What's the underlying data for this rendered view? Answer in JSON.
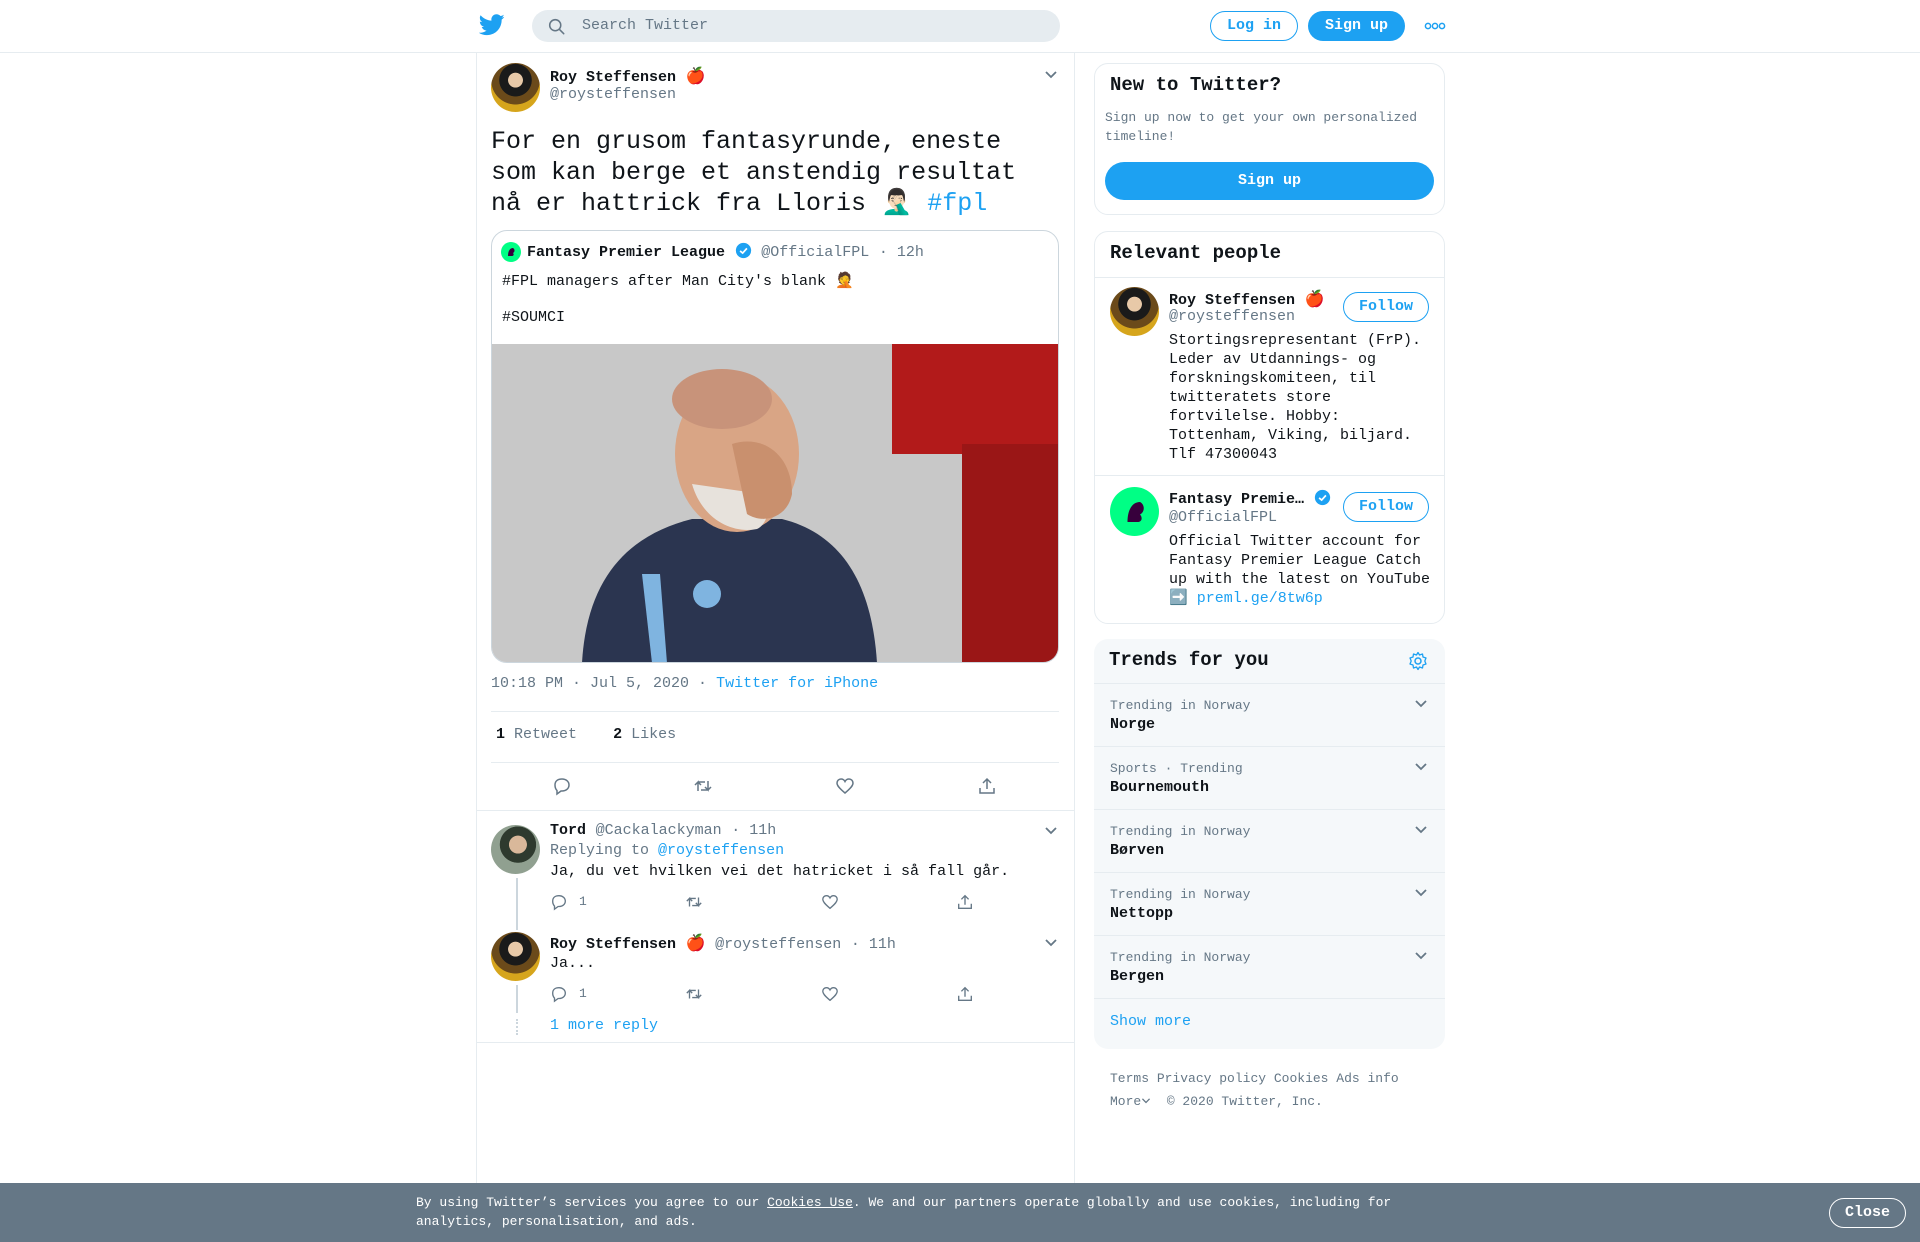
{
  "header": {
    "search_placeholder": "Search Twitter",
    "login_label": "Log in",
    "signup_label": "Sign up"
  },
  "main_tweet": {
    "author_name": "Roy Steffensen",
    "author_emoji": "🍎",
    "author_handle": "@roysteffensen",
    "text": "For en grusom fantasyrunde, eneste som kan berge et anstendig resultat nå er hattrick fra Lloris 🤦🏻‍♂️",
    "hashtag": "#fpl",
    "quoted": {
      "author_name": "Fantasy Premier League",
      "author_handle": "@OfficialFPL",
      "time": "· 12h",
      "line1": "#FPL managers after Man City's blank 🤦",
      "line2": "#SOUMCI"
    },
    "time": "10:18 PM · Jul 5, 2020 ·",
    "source": "Twitter for iPhone",
    "retweet_count": "1",
    "retweet_label": "Retweet",
    "like_count": "2",
    "like_label": "Likes"
  },
  "replies": [
    {
      "author_name": "Tord",
      "author_handle": "@Cackalackyman",
      "time": "· 11h",
      "replying_to_label": "Replying to",
      "replying_to_handle": "@roysteffensen",
      "text": "Ja, du vet hvilken vei det hatricket i så fall går.",
      "reply_count": "1"
    },
    {
      "author_name": "Roy Steffensen",
      "author_emoji": "🍎",
      "author_handle": "@roysteffensen",
      "time": "· 11h",
      "text": "Ja...",
      "reply_count": "1"
    }
  ],
  "more_replies_label": "1 more reply",
  "new_to_twitter": {
    "title": "New to Twitter?",
    "subtitle": "Sign up now to get your own personalized timeline!",
    "signup_label": "Sign up"
  },
  "relevant_people": {
    "title": "Relevant people",
    "people": [
      {
        "name": "Roy Steffensen",
        "emoji": "🍎",
        "handle": "@roysteffensen",
        "bio": "Stortingsrepresentant (FrP). Leder av Utdannings- og forskningskomiteen, til twitteratets store fortvilelse. Hobby: Tottenham, Viking, biljard. Tlf 47300043",
        "follow_label": "Follow"
      },
      {
        "name": "Fantasy Premie…",
        "handle": "@OfficialFPL",
        "bio": "Official Twitter account for Fantasy Premier League Catch up with the latest on YouTube ➡️",
        "bio_link": "preml.ge/8tw6p",
        "follow_label": "Follow"
      }
    ]
  },
  "trends": {
    "title": "Trends for you",
    "items": [
      {
        "context": "Trending in Norway",
        "name": "Norge"
      },
      {
        "context": "Sports · Trending",
        "name": "Bournemouth"
      },
      {
        "context": "Trending in Norway",
        "name": "Børven"
      },
      {
        "context": "Trending in Norway",
        "name": "Nettopp"
      },
      {
        "context": "Trending in Norway",
        "name": "Bergen"
      }
    ],
    "show_more_label": "Show more"
  },
  "footer": {
    "links": [
      "Terms",
      "Privacy policy",
      "Cookies",
      "Ads info"
    ],
    "more_label": "More",
    "copyright": "© 2020 Twitter, Inc."
  },
  "cookie_bar": {
    "text_before": "By using Twitter’s services you agree to our ",
    "link": "Cookies Use",
    "text_after": ". We and our partners operate globally and use cookies, including for analytics, personalisation, and ads.",
    "close_label": "Close"
  },
  "colors": {
    "accent": "#1da1f2",
    "text": "#0f1419",
    "secondary": "#657786",
    "border": "#e6ecf0",
    "cookie_bar": "#657786",
    "fpl_green": "#00ff85"
  }
}
